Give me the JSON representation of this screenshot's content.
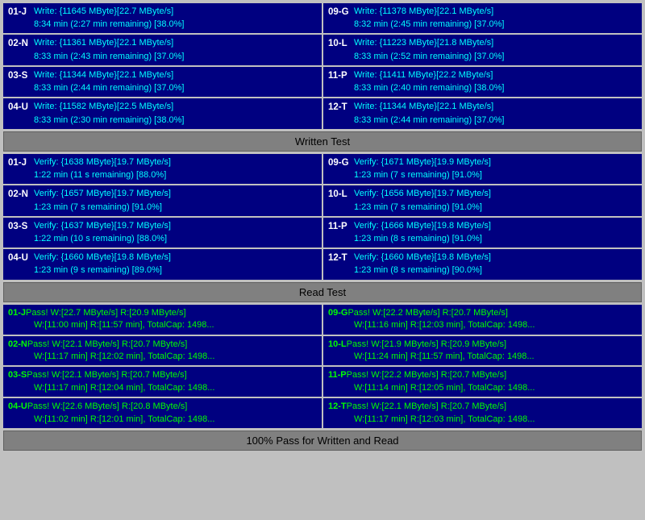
{
  "sections": {
    "write_test": {
      "label": "Written Test",
      "left": [
        {
          "id": "01-J",
          "line1": "Write: {11645 MByte}[22.7 MByte/s]",
          "line2": "8:34 min (2:27 min remaining)  [38.0%]"
        },
        {
          "id": "02-N",
          "line1": "Write: {11361 MByte}[22.1 MByte/s]",
          "line2": "8:33 min (2:43 min remaining)  [37.0%]"
        },
        {
          "id": "03-S",
          "line1": "Write: {11344 MByte}[22.1 MByte/s]",
          "line2": "8:33 min (2:44 min remaining)  [37.0%]"
        },
        {
          "id": "04-U",
          "line1": "Write: {11582 MByte}[22.5 MByte/s]",
          "line2": "8:33 min (2:30 min remaining)  [38.0%]"
        }
      ],
      "right": [
        {
          "id": "09-G",
          "line1": "Write: {11378 MByte}[22.1 MByte/s]",
          "line2": "8:32 min (2:45 min remaining)  [37.0%]"
        },
        {
          "id": "10-L",
          "line1": "Write: {11223 MByte}[21.8 MByte/s]",
          "line2": "8:33 min (2:52 min remaining)  [37.0%]"
        },
        {
          "id": "11-P",
          "line1": "Write: {11411 MByte}[22.2 MByte/s]",
          "line2": "8:33 min (2:40 min remaining)  [38.0%]"
        },
        {
          "id": "12-T",
          "line1": "Write: {11344 MByte}[22.1 MByte/s]",
          "line2": "8:33 min (2:44 min remaining)  [37.0%]"
        }
      ]
    },
    "verify_test": {
      "left": [
        {
          "id": "01-J",
          "line1": "Verify: {1638 MByte}[19.7 MByte/s]",
          "line2": "1:22 min (11 s remaining)  [88.0%]"
        },
        {
          "id": "02-N",
          "line1": "Verify: {1657 MByte}[19.7 MByte/s]",
          "line2": "1:23 min (7 s remaining)  [91.0%]"
        },
        {
          "id": "03-S",
          "line1": "Verify: {1637 MByte}[19.7 MByte/s]",
          "line2": "1:22 min (10 s remaining)  [88.0%]"
        },
        {
          "id": "04-U",
          "line1": "Verify: {1660 MByte}[19.8 MByte/s]",
          "line2": "1:23 min (9 s remaining)  [89.0%]"
        }
      ],
      "right": [
        {
          "id": "09-G",
          "line1": "Verify: {1671 MByte}[19.9 MByte/s]",
          "line2": "1:23 min (7 s remaining)  [91.0%]"
        },
        {
          "id": "10-L",
          "line1": "Verify: {1656 MByte}[19.7 MByte/s]",
          "line2": "1:23 min (7 s remaining)  [91.0%]"
        },
        {
          "id": "11-P",
          "line1": "Verify: {1666 MByte}[19.8 MByte/s]",
          "line2": "1:23 min (8 s remaining)  [91.0%]"
        },
        {
          "id": "12-T",
          "line1": "Verify: {1660 MByte}[19.8 MByte/s]",
          "line2": "1:23 min (8 s remaining)  [90.0%]"
        }
      ]
    },
    "read_test": {
      "label": "Read Test",
      "left": [
        {
          "id": "01-J",
          "line1": "Pass! W:[22.7 MByte/s] R:[20.9 MByte/s]",
          "line2": "W:[11:00 min] R:[11:57 min], TotalCap: 1498..."
        },
        {
          "id": "02-N",
          "line1": "Pass! W:[22.1 MByte/s] R:[20.7 MByte/s]",
          "line2": "W:[11:17 min] R:[12:02 min], TotalCap: 1498..."
        },
        {
          "id": "03-S",
          "line1": "Pass! W:[22.1 MByte/s] R:[20.7 MByte/s]",
          "line2": "W:[11:17 min] R:[12:04 min], TotalCap: 1498..."
        },
        {
          "id": "04-U",
          "line1": "Pass! W:[22.6 MByte/s] R:[20.8 MByte/s]",
          "line2": "W:[11:02 min] R:[12:01 min], TotalCap: 1498..."
        }
      ],
      "right": [
        {
          "id": "09-G",
          "line1": "Pass! W:[22.2 MByte/s] R:[20.7 MByte/s]",
          "line2": "W:[11:16 min] R:[12:03 min], TotalCap: 1498..."
        },
        {
          "id": "10-L",
          "line1": "Pass! W:[21.9 MByte/s] R:[20.9 MByte/s]",
          "line2": "W:[11:24 min] R:[11:57 min], TotalCap: 1498..."
        },
        {
          "id": "11-P",
          "line1": "Pass! W:[22.2 MByte/s] R:[20.7 MByte/s]",
          "line2": "W:[11:14 min] R:[12:05 min], TotalCap: 1498..."
        },
        {
          "id": "12-T",
          "line1": "Pass! W:[22.1 MByte/s] R:[20.7 MByte/s]",
          "line2": "W:[11:17 min] R:[12:03 min], TotalCap: 1498..."
        }
      ]
    }
  },
  "headers": {
    "written_test": "Written Test",
    "read_test": "Read Test",
    "footer": "100% Pass for Written and Read"
  }
}
